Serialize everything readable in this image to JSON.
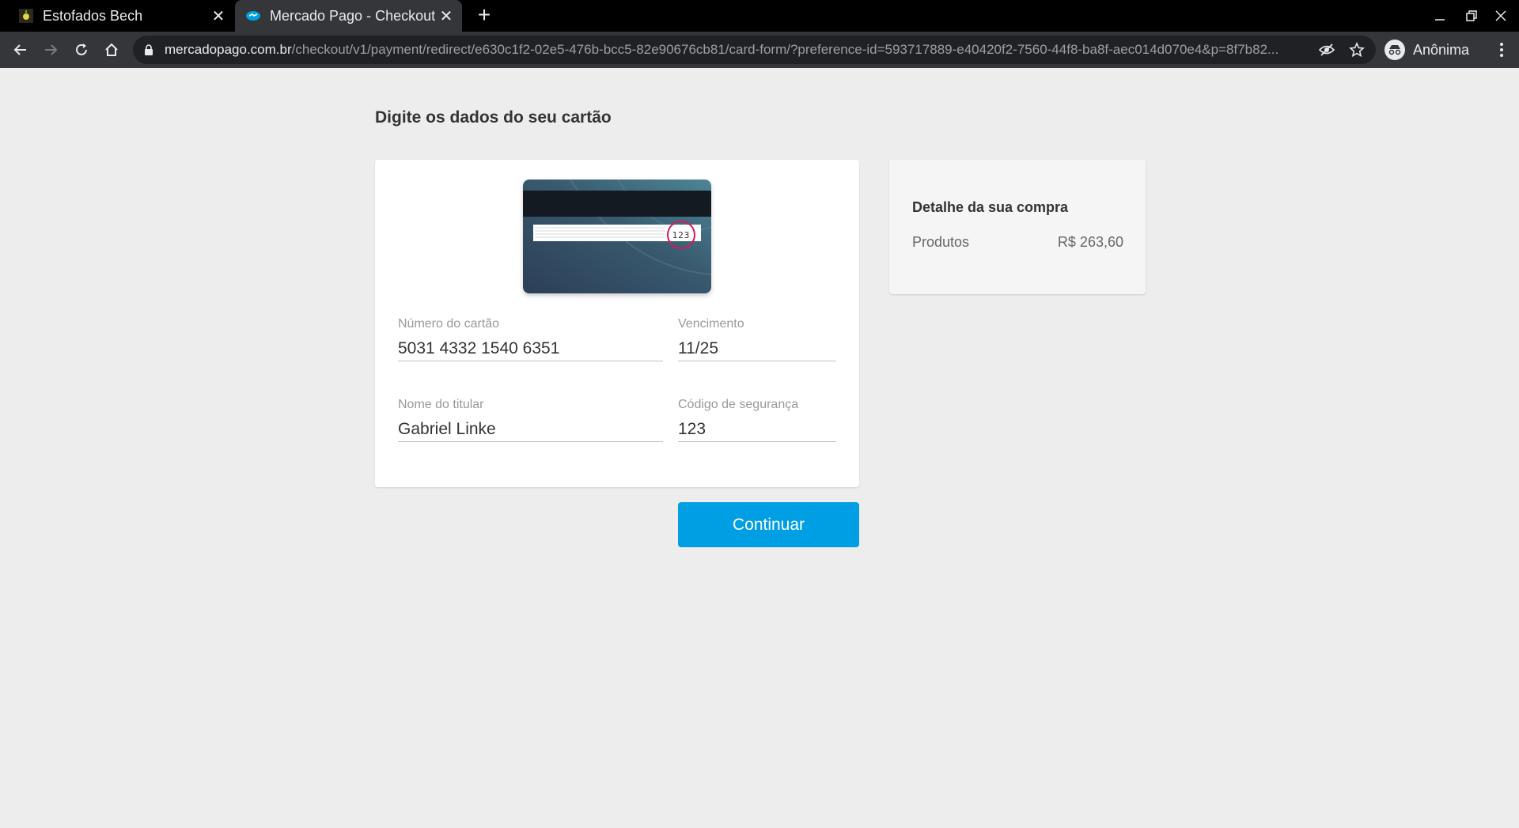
{
  "browser": {
    "tabs": [
      {
        "title": "Estofados Bech",
        "favicon": "estofados-favicon",
        "active": false
      },
      {
        "title": "Mercado Pago - Checkout",
        "favicon": "mercadopago-handshake-icon",
        "active": true
      }
    ],
    "url_host": "mercadopago.com.br",
    "url_path": "/checkout/v1/payment/redirect/e630c1f2-02e5-476b-bcc5-82e90676cb81/card-form/?preference-id=593717889-e40420f2-7560-44f8-ba8f-aec014d070e4&p=8f7b82...",
    "profile_label": "Anônima"
  },
  "page": {
    "title": "Digite os dados do seu cartão"
  },
  "card_form": {
    "card_cvv_preview": "123",
    "fields": {
      "card_number": {
        "label": "Número do cartão",
        "value": "5031 4332 1540 6351"
      },
      "expiry": {
        "label": "Vencimento",
        "value": "11/25"
      },
      "holder_name": {
        "label": "Nome do titular",
        "value": "Gabriel Linke"
      },
      "security_code": {
        "label": "Código de segurança",
        "value": "123"
      }
    },
    "continue_label": "Continuar"
  },
  "summary": {
    "title": "Detalhe da sua compra",
    "rows": [
      {
        "label": "Produtos",
        "value": "R$ 263,60"
      }
    ]
  },
  "colors": {
    "accent": "#009ee3",
    "page_bg": "#ededed",
    "cvv_circle": "#d6195c"
  }
}
